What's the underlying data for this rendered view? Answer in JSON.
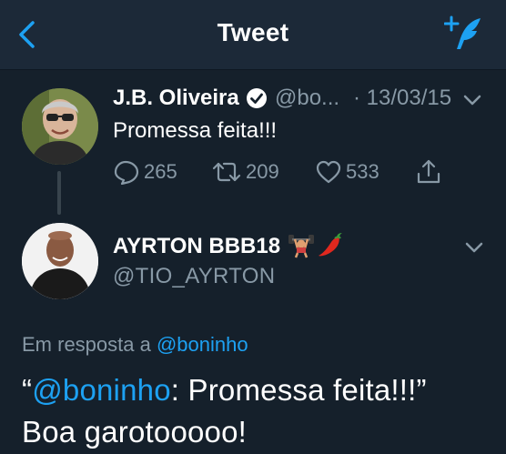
{
  "header": {
    "title": "Tweet"
  },
  "tweet1": {
    "display_name": "J.B. Oliveira",
    "handle": "@bo...",
    "date": "· 13/03/15",
    "text": "Promessa feita!!!",
    "reply_count": "265",
    "retweet_count": "209",
    "like_count": "533"
  },
  "tweet2": {
    "display_name": "AYRTON BBB18",
    "emojis": [
      "weight-lifter-emoji",
      "hot-pepper-emoji"
    ],
    "handle": "@TIO_AYRTON",
    "reply_prefix": "Em resposta a",
    "reply_mention": "@boninho",
    "quote_open": "“",
    "quote_mention": "@boninho",
    "quote_text": ": Promessa feita!!!”",
    "line2": "Boa garotooooo!"
  },
  "colors": {
    "background": "#15202b",
    "header": "#1c2938",
    "accent": "#1da1f2",
    "muted": "#8899a6"
  }
}
